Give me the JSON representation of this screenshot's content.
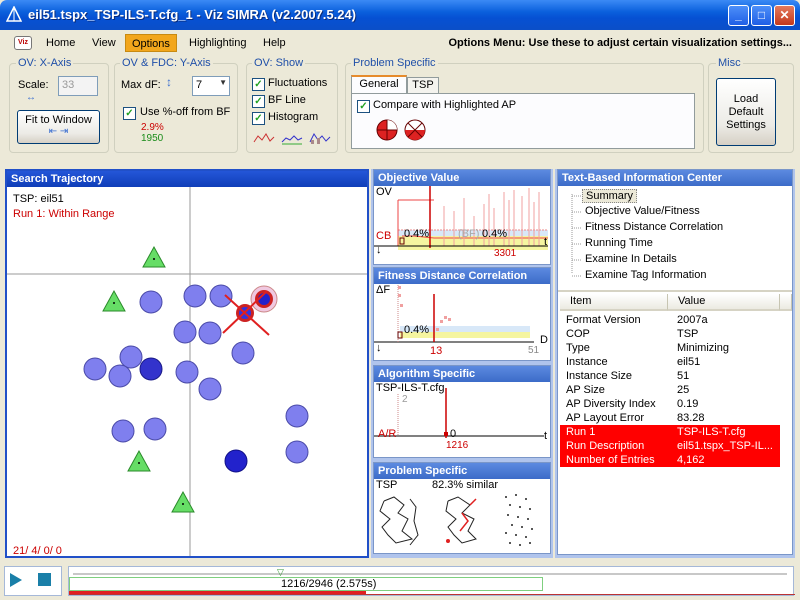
{
  "window": {
    "title": "eil51.tspx_TSP-ILS-T.cfg_1 - Viz SIMRA (v2.2007.5.24)",
    "buttons": {
      "minimize": "_",
      "maximize": "□",
      "close": "✕"
    }
  },
  "menu": {
    "logo": "Viz",
    "items": [
      "Home",
      "View",
      "Options",
      "Highlighting",
      "Help"
    ],
    "hint": "Options Menu: Use these to adjust certain visualization settings..."
  },
  "ov_xaxis": {
    "title": "OV: X-Axis",
    "scale_label": "Scale:",
    "scale_value": "33",
    "fit_button": "Fit to Window"
  },
  "ov_fdc": {
    "title": "OV & FDC: Y-Axis",
    "maxdf_label": "Max dF:",
    "maxdf_value": "7",
    "use_pct_label": "Use %-off from BF",
    "pct_value": "2.9%",
    "bf_value": "1950"
  },
  "ov_show": {
    "title": "OV: Show",
    "items": [
      "Fluctuations",
      "BF Line",
      "Histogram"
    ]
  },
  "problem_specific": {
    "title": "Problem Specific",
    "tabs": [
      "General",
      "TSP"
    ],
    "compare_label": "Compare with Highlighted AP"
  },
  "misc": {
    "title": "Misc",
    "load_button": "Load Default Settings"
  },
  "search_panel": {
    "title": "Search Trajectory",
    "line1": "TSP: eil51",
    "line2": "Run 1: Within Range",
    "footer": "21/ 4/ 0/ 0"
  },
  "objective_panel": {
    "title": "Objective Value",
    "ov": "OV",
    "cb": "CB",
    "pct1": "0.4%",
    "bf": "(BF)",
    "pct2": "0.4%",
    "t": "t",
    "count": "3301"
  },
  "fdc_panel": {
    "title": "Fitness Distance Correlation",
    "df": "ΔF",
    "pct": "0.4%",
    "d": "D",
    "d_value": "13",
    "d_max": "51"
  },
  "algo_panel": {
    "title": "Algorithm Specific",
    "cfg": "TSP-ILS-T.cfg",
    "y_tick": "2",
    "ar": "A/R",
    "zero": "0",
    "t": "t",
    "iter": "1216"
  },
  "problem_panel": {
    "title": "Problem Specific",
    "label": "TSP",
    "similar": "82.3% similar"
  },
  "info_center": {
    "title": "Text-Based Information Center",
    "tree": [
      "Summary",
      "Objective Value/Fitness",
      "Fitness Distance Correlation",
      "Running Time",
      "Examine In Details",
      "Examine Tag Information"
    ],
    "columns": [
      "Item",
      "Value"
    ],
    "rows": [
      {
        "item": "Format Version",
        "value": "2007a",
        "hl": false
      },
      {
        "item": "COP",
        "value": "TSP",
        "hl": false
      },
      {
        "item": "Type",
        "value": "Minimizing",
        "hl": false
      },
      {
        "item": "Instance",
        "value": "eil51",
        "hl": false
      },
      {
        "item": "Instance Size",
        "value": "51",
        "hl": false
      },
      {
        "item": "AP Size",
        "value": "25",
        "hl": false
      },
      {
        "item": "AP Diversity Index",
        "value": "0.19",
        "hl": false
      },
      {
        "item": "AP Layout Error",
        "value": "83.28",
        "hl": false
      },
      {
        "item": "Run 1",
        "value": "TSP-ILS-T.cfg",
        "hl": true
      },
      {
        "item": "Run Description",
        "value": "eil51.tspx_TSP-IL...",
        "hl": true
      },
      {
        "item": "Number of Entries",
        "value": "4,162",
        "hl": true
      }
    ]
  },
  "playback": {
    "position": "1216/2946 (2.575s)",
    "progress": 0.41
  }
}
